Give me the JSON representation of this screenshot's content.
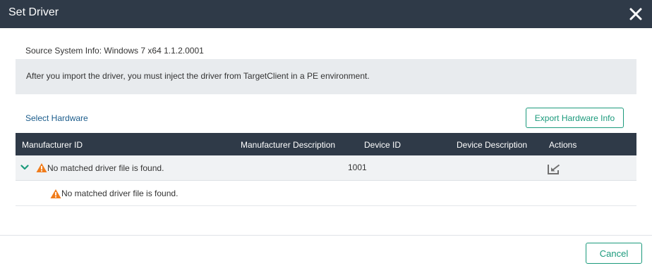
{
  "dialog": {
    "title": "Set Driver",
    "close_icon": "close-icon"
  },
  "source_info": "Source System Info: Windows 7 x64 1.1.2.0001",
  "notice": "After you import the driver, you must inject the driver from TargetClient in a PE environment.",
  "select_hardware_label": "Select Hardware",
  "export_button_label": "Export Hardware Info",
  "table": {
    "columns": [
      "Manufacturer ID",
      "Manufacturer Description",
      "Device ID",
      "Device Description",
      "Actions"
    ],
    "rows": [
      {
        "manufacturer_id": "No matched driver file is found.",
        "manufacturer_description": "",
        "device_id": "1001",
        "device_description": "",
        "expanded": true,
        "status_icon": "warning-icon",
        "action_icon": "import-icon"
      }
    ],
    "child_rows": [
      {
        "manufacturer_id": "No matched driver file is found.",
        "status_icon": "warning-icon"
      }
    ]
  },
  "footer": {
    "cancel_label": "Cancel"
  },
  "colors": {
    "header_bg": "#2f3a48",
    "accent": "#1b9a7c",
    "link": "#1c5d8c",
    "warning": "#f07c1b",
    "notice_bg": "#e8ebee"
  }
}
